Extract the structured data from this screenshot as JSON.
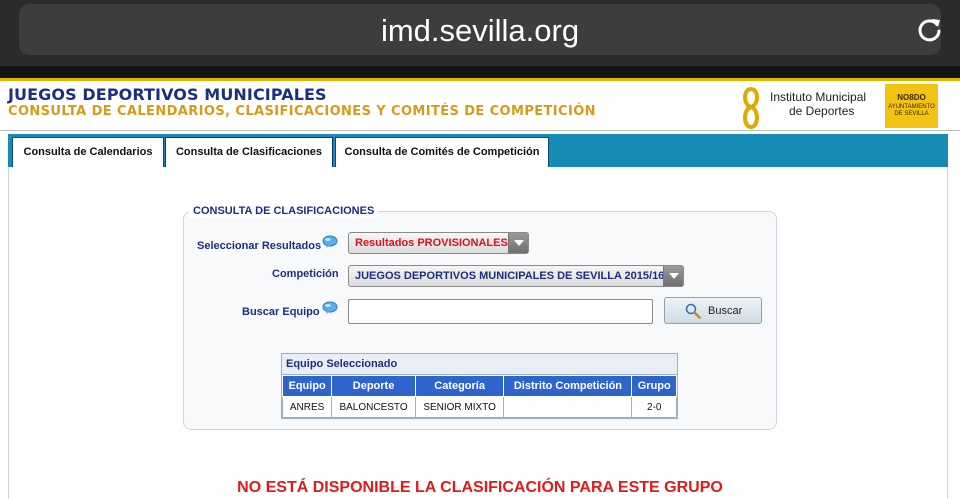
{
  "browser": {
    "url": "imd.sevilla.org"
  },
  "header": {
    "title": "JUEGOS DEPORTIVOS MUNICIPALES",
    "subtitle": "CONSULTA DE CALENDARIOS, CLASIFICACIONES Y COMITÉS DE COMPETICIÓN",
    "logo_line1": "Instituto Municipal",
    "logo_line2": "de Deportes",
    "seal_line1": "NO8DO",
    "seal_line2": "AYUNTAMIENTO DE SEVILLA"
  },
  "tabs": [
    {
      "label": "Consulta de Calendarios"
    },
    {
      "label": "Consulta de Clasificaciones",
      "active": true
    },
    {
      "label": "Consulta de Comités de Competición"
    }
  ],
  "form": {
    "legend": "CONSULTA DE CLASIFICACIONES",
    "results_label": "Seleccionar Resultados",
    "results_value": "Resultados PROVISIONALES",
    "competition_label": "Competición",
    "competition_value": "JUEGOS DEPORTIVOS MUNICIPALES DE SEVILLA 2015/16",
    "search_label": "Buscar Equipo",
    "search_value": "",
    "search_button": "Buscar"
  },
  "table": {
    "caption": "Equipo Seleccionado",
    "headers": [
      "Equipo",
      "Deporte",
      "Categoría",
      "Distrito Competición",
      "Grupo"
    ],
    "rows": [
      [
        "ANRES",
        "BALONCESTO",
        "SENIOR MIXTO",
        "",
        "2-0"
      ]
    ]
  },
  "notice": "NO ESTÁ DISPONIBLE LA CLASIFICACIÓN PARA ESTE GRUPO",
  "colors": {
    "accent": "#168bb5",
    "brand_blue": "#1b2f80",
    "gold": "#d89a1a",
    "error": "#e21a1a"
  }
}
